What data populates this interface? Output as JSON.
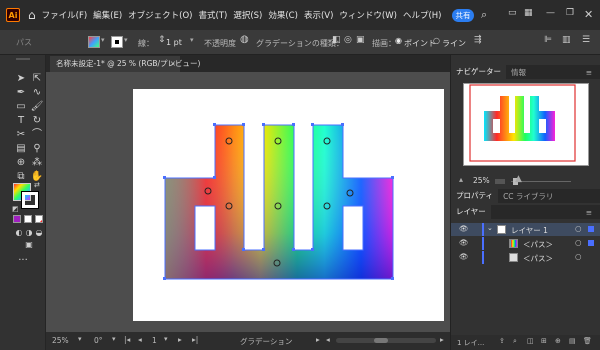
{
  "app": {
    "logo_text": "Ai"
  },
  "menu": {
    "items": [
      "ファイル(F)",
      "編集(E)",
      "オブジェクト(O)",
      "書式(T)",
      "選択(S)",
      "効果(C)",
      "表示(V)",
      "ウィンドウ(W)",
      "ヘルプ(H)"
    ]
  },
  "header": {
    "share_label": "共有"
  },
  "control_bar": {
    "object_type": "パス",
    "stroke_label": "線：",
    "stroke_value": "1 pt",
    "opacity_label": "不透明度",
    "gradient_type_label": "グラデーションの種類：",
    "draw_label": "描画：",
    "point_label": "ポイント",
    "line_label": "ライン"
  },
  "document": {
    "tab_title": "名称未設定-1* @ 25 % (RGB/プレビュー)",
    "close_glyph": "×"
  },
  "status_bar": {
    "zoom": "25%",
    "rotation": "0°",
    "page": "1",
    "tool_name": "グラデーション"
  },
  "navigator": {
    "tabs": [
      "ナビゲーター",
      "情報"
    ],
    "zoom": "25%"
  },
  "properties": {
    "tabs": [
      "プロパティ",
      "CC ライブラリ"
    ]
  },
  "layers": {
    "tab": "レイヤー",
    "rows": [
      {
        "name": "レイヤー 1"
      },
      {
        "name": "＜パス＞"
      },
      {
        "name": "＜パス＞"
      }
    ],
    "footer_count": "1 レイ..."
  },
  "colors": {
    "accent": "#2b7df0",
    "layer_color": "#4a6fff",
    "nav_red": "#e03030"
  }
}
